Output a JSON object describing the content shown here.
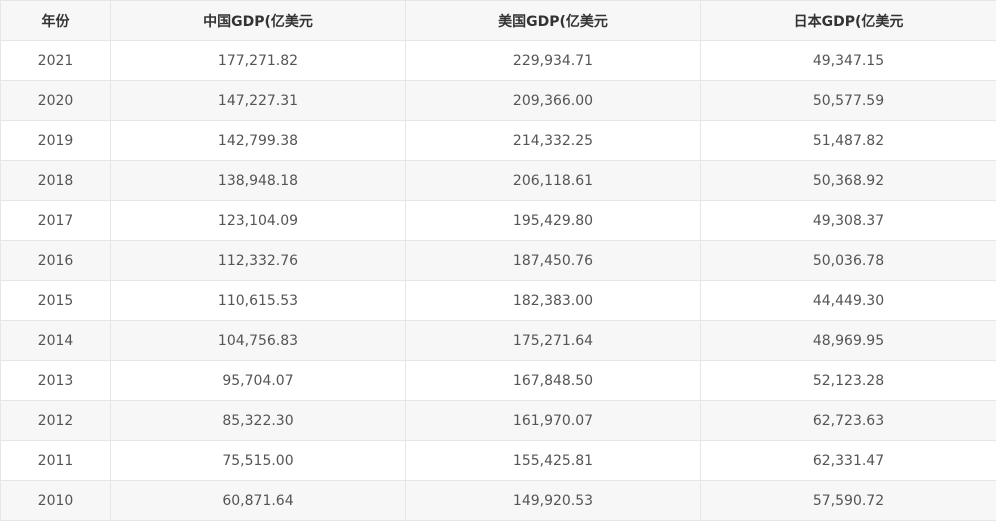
{
  "table": {
    "headers": [
      "年份",
      "中国GDP(亿美元",
      "美国GDP(亿美元",
      "日本GDP(亿美元"
    ],
    "rows": [
      [
        "2021",
        "177,271.82",
        "229,934.71",
        "49,347.15"
      ],
      [
        "2020",
        "147,227.31",
        "209,366.00",
        "50,577.59"
      ],
      [
        "2019",
        "142,799.38",
        "214,332.25",
        "51,487.82"
      ],
      [
        "2018",
        "138,948.18",
        "206,118.61",
        "50,368.92"
      ],
      [
        "2017",
        "123,104.09",
        "195,429.80",
        "49,308.37"
      ],
      [
        "2016",
        "112,332.76",
        "187,450.76",
        "50,036.78"
      ],
      [
        "2015",
        "110,615.53",
        "182,383.00",
        "44,449.30"
      ],
      [
        "2014",
        "104,756.83",
        "175,271.64",
        "48,969.95"
      ],
      [
        "2013",
        "95,704.07",
        "167,848.50",
        "52,123.28"
      ],
      [
        "2012",
        "85,322.30",
        "161,970.07",
        "62,723.63"
      ],
      [
        "2011",
        "75,515.00",
        "155,425.81",
        "62,331.47"
      ],
      [
        "2010",
        "60,871.64",
        "149,920.53",
        "57,590.72"
      ]
    ]
  }
}
